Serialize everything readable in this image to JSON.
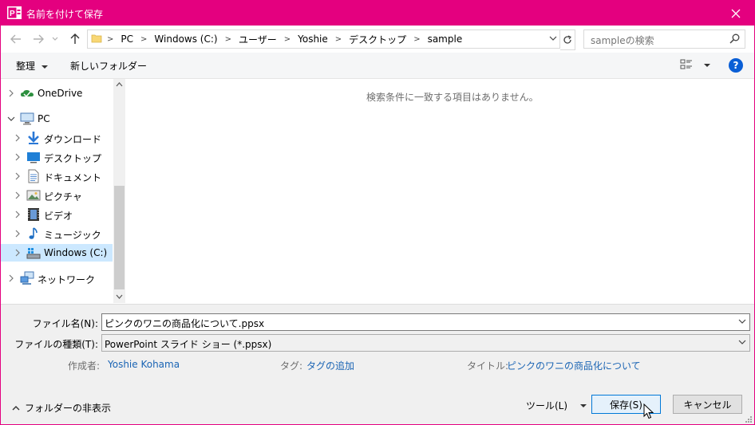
{
  "window": {
    "title": "名前を付けて保存",
    "app_icon_text": "P"
  },
  "address": {
    "crumbs": [
      "PC",
      "Windows (C:)",
      "ユーザー",
      "Yoshie",
      "デスクトップ",
      "sample"
    ],
    "search_placeholder": "sampleの検索"
  },
  "toolbar": {
    "organize": "整理",
    "new_folder": "新しいフォルダー"
  },
  "nav": {
    "onedrive": "OneDrive",
    "pc": "PC",
    "items": [
      "ダウンロード",
      "デスクトップ",
      "ドキュメント",
      "ピクチャ",
      "ビデオ",
      "ミュージック",
      "Windows (C:)"
    ],
    "network": "ネットワーク"
  },
  "content": {
    "empty_message": "検索条件に一致する項目はありません。"
  },
  "details": {
    "filename_label": "ファイル名(N):",
    "filename_value": "ピンクのワニの商品化について.ppsx",
    "filetype_label": "ファイルの種類(T):",
    "filetype_value": "PowerPoint スライド ショー (*.ppsx)",
    "author_label": "作成者:",
    "author_value": "Yoshie Kohama",
    "tags_label": "タグ:",
    "tags_value": "タグの追加",
    "title_label": "タイトル:",
    "title_value": "ピンクのワニの商品化について"
  },
  "footer": {
    "hide_folders": "フォルダーの非表示",
    "tools": "ツール(L)",
    "save": "保存(S)",
    "cancel": "キャンセル"
  },
  "colors": {
    "accent": "#e4007f",
    "link": "#1a64b4",
    "selection": "#cce8ff"
  }
}
